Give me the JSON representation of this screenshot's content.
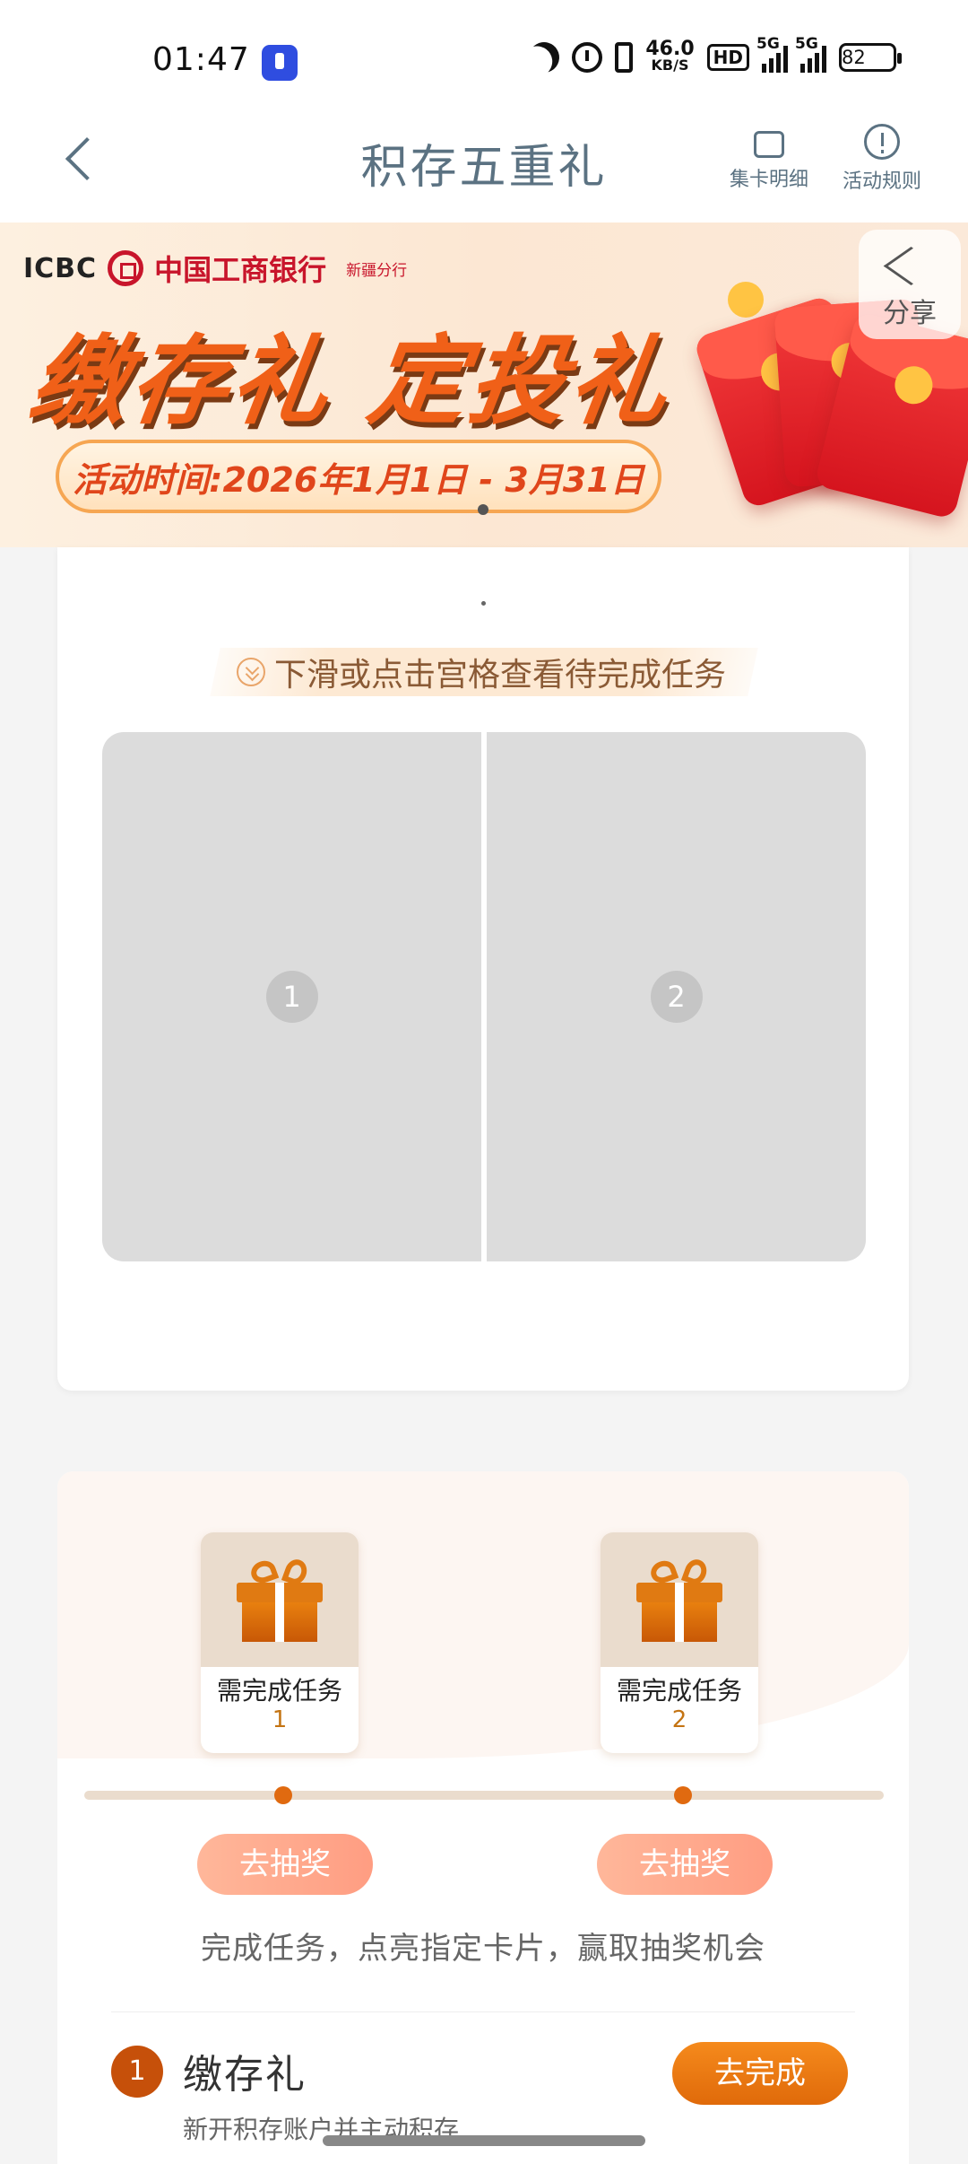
{
  "status_bar": {
    "time": "01:47",
    "speed_value": "46.0",
    "speed_unit": "KB/S",
    "hd_label": "HD",
    "signal1_label": "5G",
    "signal2_label": "5G",
    "battery": "82"
  },
  "nav": {
    "title": "积存五重礼",
    "card_details": "集卡明细",
    "rules": "活动规则"
  },
  "banner": {
    "brand": "ICBC",
    "bank_name": "中国工商银行",
    "branch": "新疆分行",
    "headline": "缴存礼 定投礼",
    "period": "活动时间:2026年1月1日 - 3月31日",
    "share_label": "分享"
  },
  "grid": {
    "hint": "下滑或点击宫格查看待完成任务",
    "tiles": [
      "1",
      "2"
    ]
  },
  "rewards": {
    "milestones": [
      {
        "label": "需完成任务",
        "count": "1",
        "button": "去抽奖"
      },
      {
        "label": "需完成任务",
        "count": "2",
        "button": "去抽奖"
      }
    ],
    "tip": "完成任务，点亮指定卡片，赢取抽奖机会"
  },
  "tasks": [
    {
      "index": "1",
      "title": "缴存礼",
      "subtitle": "新开积存账户并主动积存",
      "button": "去完成"
    }
  ],
  "colors": {
    "primary": "#e06a0a",
    "nav_text": "#5b7282",
    "tile": "#dcdcdc"
  }
}
